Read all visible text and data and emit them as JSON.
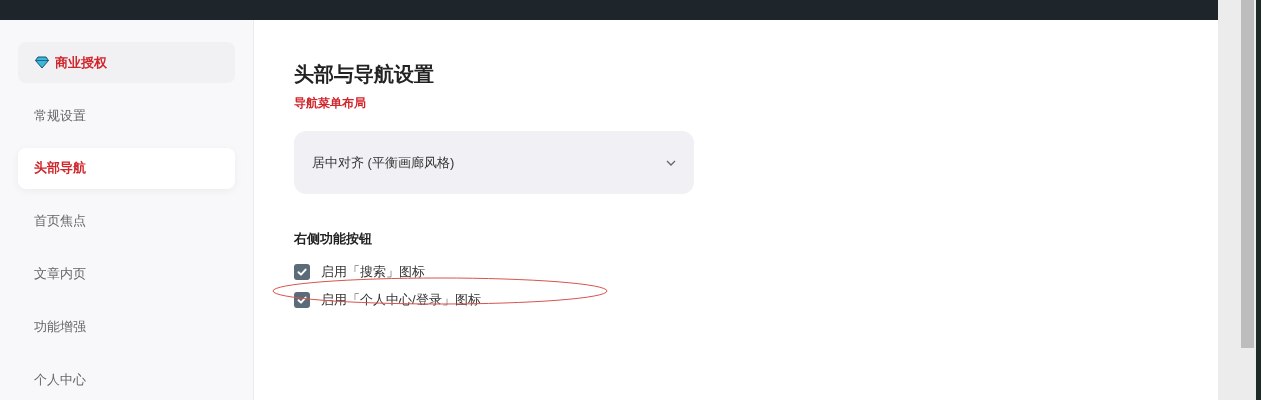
{
  "sidebar": {
    "license": {
      "label": "商业授权"
    },
    "items": [
      {
        "label": "常规设置",
        "selected": false
      },
      {
        "label": "头部导航",
        "selected": true
      },
      {
        "label": "首页焦点",
        "selected": false
      },
      {
        "label": "文章内页",
        "selected": false
      },
      {
        "label": "功能增强",
        "selected": false
      },
      {
        "label": "个人中心",
        "selected": false
      }
    ]
  },
  "main": {
    "title": "头部与导航设置",
    "section_label": "导航菜单布局",
    "dropdown": {
      "value": "居中对齐 (平衡画廊风格)"
    },
    "group_title": "右侧功能按钮",
    "checkboxes": [
      {
        "label": "启用「搜索」图标",
        "checked": true
      },
      {
        "label": "启用「个人中心/登录」图标",
        "checked": true
      }
    ]
  }
}
